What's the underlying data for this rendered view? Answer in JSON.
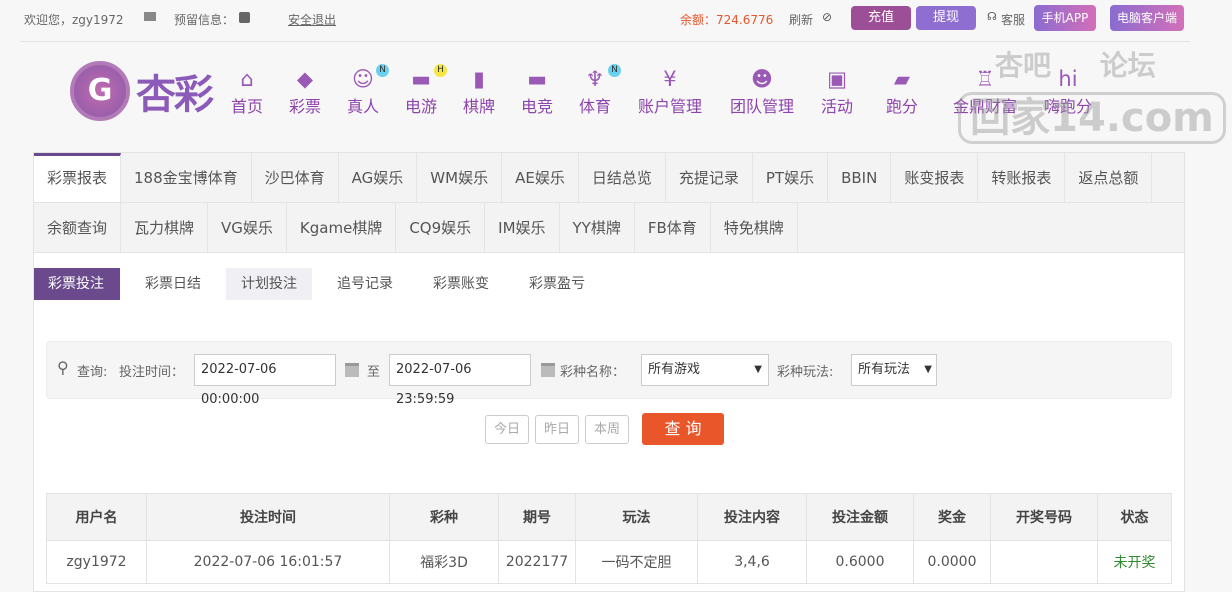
{
  "topbar": {
    "welcome": "欢迎您，zgy1972",
    "reserved_info": "预留信息：",
    "logout": "安全退出",
    "balance": "余额：724.6776",
    "refresh": "刷新",
    "recharge": "充值",
    "withdraw": "提现",
    "service": "客服",
    "mobile_app": "手机APP",
    "pc_client": "电脑客户端"
  },
  "logo": {
    "text": "杏彩"
  },
  "watermark": {
    "text": "杏吧 论坛 回家14.com"
  },
  "nav": [
    {
      "label": "首页",
      "icon": "home-icon"
    },
    {
      "label": "彩票",
      "icon": "ticket-icon"
    },
    {
      "label": "真人",
      "icon": "live-dealer-icon",
      "badge": "N"
    },
    {
      "label": "电游",
      "icon": "gamepad-icon",
      "badge": "H"
    },
    {
      "label": "棋牌",
      "icon": "cards-icon"
    },
    {
      "label": "电竞",
      "icon": "esports-icon"
    },
    {
      "label": "体育",
      "icon": "trophy-icon",
      "badge": "N"
    },
    {
      "label": "账户管理",
      "icon": "yen-coin-icon"
    },
    {
      "label": "团队管理",
      "icon": "team-icon"
    },
    {
      "label": "活动",
      "icon": "gift-icon"
    },
    {
      "label": "跑分",
      "icon": "rhino-icon"
    },
    {
      "label": "金鼎财富",
      "icon": "tripod-icon"
    },
    {
      "label": "嗨跑分",
      "icon": "hi-icon"
    }
  ],
  "report_tabs_row1": [
    "彩票报表",
    "188金宝博体育",
    "沙巴体育",
    "AG娱乐",
    "WM娱乐",
    "AE娱乐",
    "日结总览",
    "充提记录",
    "PT娱乐",
    "BBIN",
    "账变报表",
    "转账报表",
    "返点总额"
  ],
  "report_tabs_row2": [
    "余额查询",
    "瓦力棋牌",
    "VG娱乐",
    "Kgame棋牌",
    "CQ9娱乐",
    "IM娱乐",
    "YY棋牌",
    "FB体育",
    "特免棋牌"
  ],
  "sub_tabs": [
    "彩票投注",
    "彩票日结",
    "计划投注",
    "追号记录",
    "彩票账变",
    "彩票盈亏"
  ],
  "filter": {
    "query_label": "查询:",
    "time_label": "投注时间：",
    "start": "2022-07-06 00:00:00",
    "to": "至",
    "end": "2022-07-06 23:59:59",
    "game_label": "彩种名称：",
    "game_value": "所有游戏",
    "play_label": "彩种玩法:",
    "play_value": "所有玩法",
    "today": "今日",
    "yesterday": "昨日",
    "this_week": "本周",
    "search": "查 询"
  },
  "table": {
    "headers": [
      "用户名",
      "投注时间",
      "彩种",
      "期号",
      "玩法",
      "投注内容",
      "投注金额",
      "奖金",
      "开奖号码",
      "状态"
    ],
    "rows": [
      [
        "zgy1972",
        "2022-07-06 16:01:57",
        "福彩3D",
        "2022177",
        "一码不定胆",
        "3,4,6",
        "0.6000",
        "0.0000",
        "",
        "未开奖"
      ]
    ]
  },
  "colors": {
    "accent": "#6a4a8c",
    "search_button": "#e8562a",
    "balance": "#e8562a",
    "status_pending": "#2e8b2e"
  }
}
